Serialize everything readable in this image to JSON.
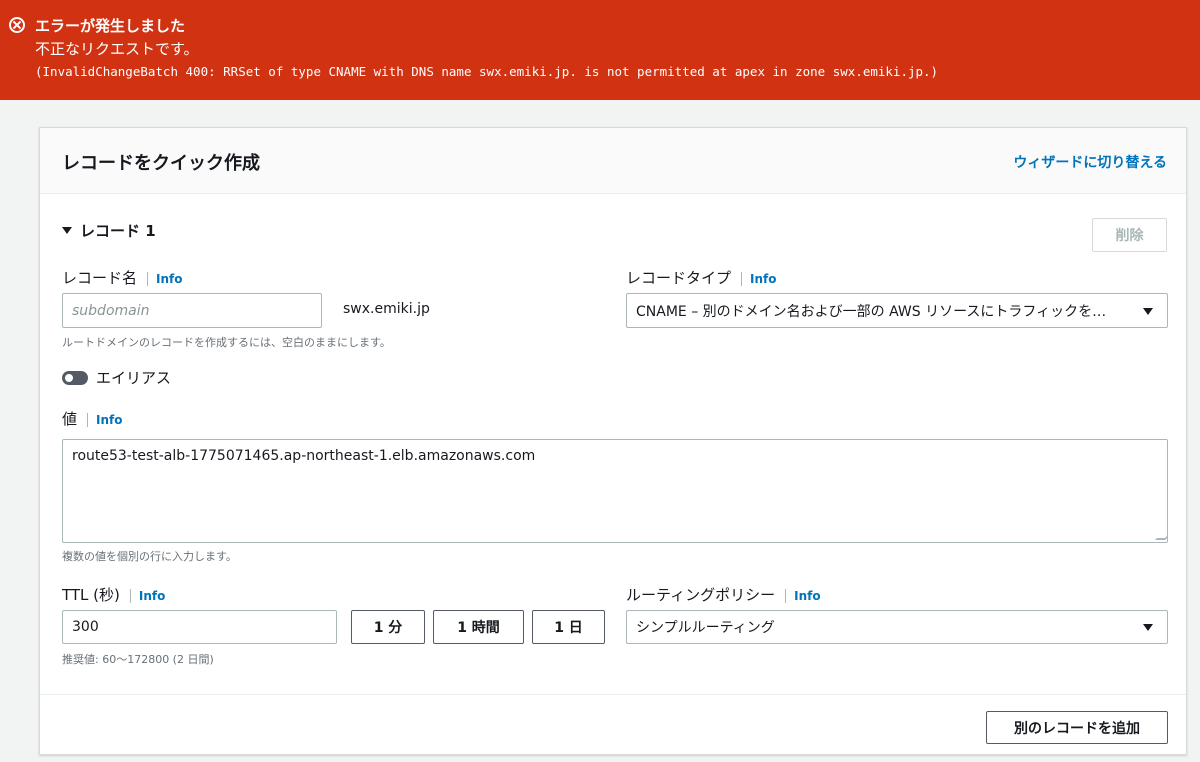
{
  "error": {
    "title": "エラーが発生しました",
    "message": "不正なリクエストです。",
    "detail": "(InvalidChangeBatch 400: RRSet of type CNAME with DNS name swx.emiki.jp. is not permitted at apex in zone swx.emiki.jp.)"
  },
  "panel": {
    "title": "レコードをクイック作成",
    "wizard_link": "ウィザードに切り替える",
    "section_title": "レコード 1",
    "delete_label": "削除",
    "add_record_label": "別のレコードを追加"
  },
  "info_label": "Info",
  "record_name": {
    "label": "レコード名",
    "placeholder": "subdomain",
    "domain_suffix": "swx.emiki.jp",
    "hint": "ルートドメインのレコードを作成するには、空白のままにします。"
  },
  "record_type": {
    "label": "レコードタイプ",
    "selected": "CNAME – 別のドメイン名および一部の AWS リソースにトラフィックを…"
  },
  "alias": {
    "label": "エイリアス",
    "enabled": false
  },
  "value": {
    "label": "値",
    "text": "route53-test-alb-1775071465.ap-northeast-1.elb.amazonaws.com",
    "hint": "複数の値を個別の行に入力します。"
  },
  "ttl": {
    "label": "TTL (秒)",
    "value": "300",
    "hint": "推奨値: 60～172800 (2 日間)",
    "presets": [
      "1 分",
      "1 時間",
      "1 日"
    ]
  },
  "routing": {
    "label": "ルーティングポリシー",
    "selected": "シンプルルーティング"
  },
  "colors": {
    "error_bg": "#d13212",
    "link": "#0073bb",
    "page_bg": "#f2f3f3"
  }
}
